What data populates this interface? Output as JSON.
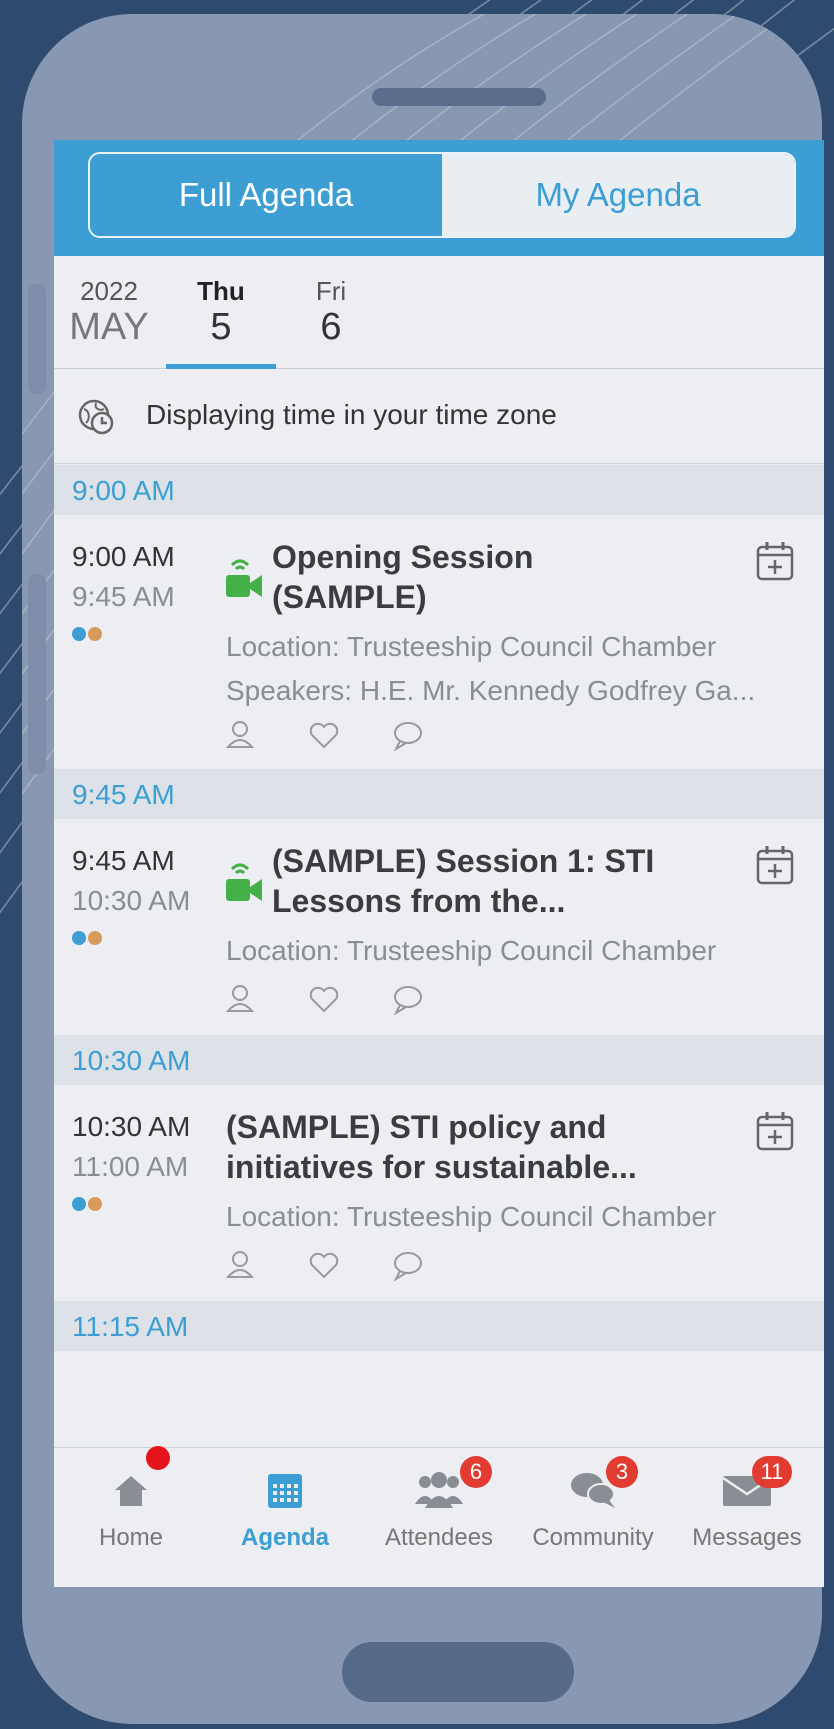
{
  "segmented": {
    "full": "Full Agenda",
    "mine": "My Agenda"
  },
  "dates": {
    "year": "2022",
    "month": "MAY",
    "days": [
      {
        "dow": "Thu",
        "num": "5"
      },
      {
        "dow": "Fri",
        "num": "6"
      }
    ]
  },
  "timezone_note": "Displaying time in your time zone",
  "sections": [
    {
      "header": "9:00 AM",
      "start": "9:00 AM",
      "end": "9:45 AM",
      "title_line1": "Opening Session",
      "title_line2": "(SAMPLE)",
      "location": "Location: Trusteeship Council Chamber",
      "speakers": "Speakers: H.E. Mr. Kennedy Godfrey Ga..."
    },
    {
      "header": "9:45 AM",
      "start": "9:45 AM",
      "end": "10:30 AM",
      "title_line1": "(SAMPLE) Session 1: STI",
      "title_line2": "Lessons from the...",
      "location": "Location: Trusteeship Council Chamber"
    },
    {
      "header": "10:30 AM",
      "start": "10:30 AM",
      "end": "11:00 AM",
      "title_line1": "(SAMPLE) STI policy and",
      "title_line2": "initiatives for sustainable...",
      "location": "Location: Trusteeship Council Chamber"
    },
    {
      "header": "11:15 AM"
    }
  ],
  "tabs": [
    {
      "label": "Home"
    },
    {
      "label": "Agenda"
    },
    {
      "label": "Attendees",
      "badge": "6"
    },
    {
      "label": "Community",
      "badge": "3"
    },
    {
      "label": "Messages",
      "badge": "11"
    }
  ],
  "colors": {
    "accent": "#3c9ed2",
    "video": "#44b04a",
    "badge": "#e23b32"
  }
}
